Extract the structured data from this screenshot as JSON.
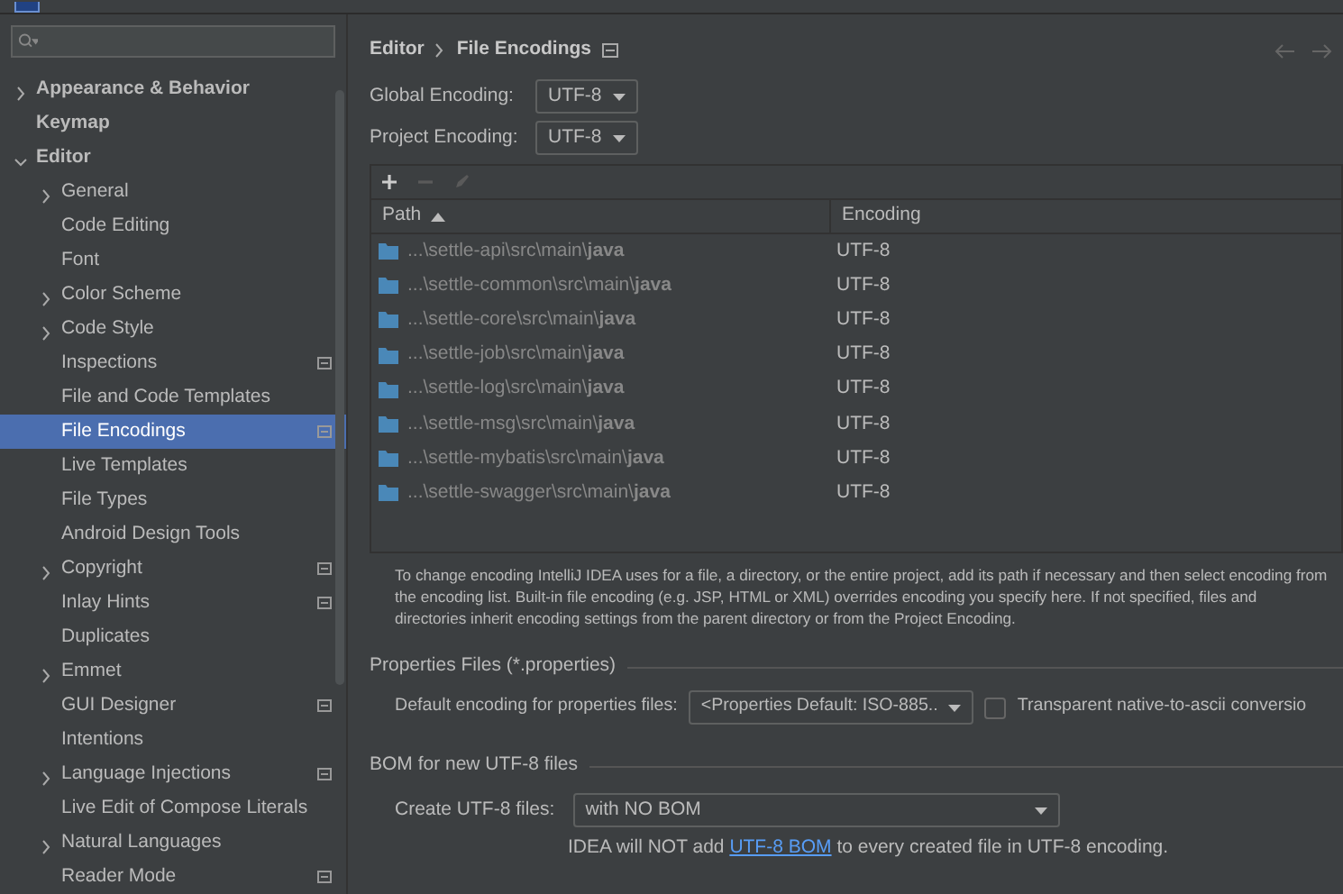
{
  "sidebar": {
    "items": [
      {
        "label": "Appearance & Behavior",
        "bold": true,
        "expanded": false,
        "selected": false
      },
      {
        "label": "Keymap",
        "bold": true,
        "selected": false
      },
      {
        "label": "Editor",
        "bold": true,
        "expanded": true,
        "selected": false,
        "children": [
          {
            "label": "General",
            "expanded": false,
            "selected": false
          },
          {
            "label": "Code Editing",
            "selected": false
          },
          {
            "label": "Font",
            "selected": false
          },
          {
            "label": "Color Scheme",
            "expanded": false,
            "selected": false
          },
          {
            "label": "Code Style",
            "expanded": false,
            "selected": false
          },
          {
            "label": "Inspections",
            "project_level": true,
            "selected": false
          },
          {
            "label": "File and Code Templates",
            "selected": false
          },
          {
            "label": "File Encodings",
            "project_level": true,
            "selected": true
          },
          {
            "label": "Live Templates",
            "selected": false
          },
          {
            "label": "File Types",
            "selected": false
          },
          {
            "label": "Android Design Tools",
            "selected": false
          },
          {
            "label": "Copyright",
            "expanded": false,
            "project_level": true,
            "selected": false
          },
          {
            "label": "Inlay Hints",
            "project_level": true,
            "selected": false
          },
          {
            "label": "Duplicates",
            "selected": false
          },
          {
            "label": "Emmet",
            "expanded": false,
            "selected": false
          },
          {
            "label": "GUI Designer",
            "project_level": true,
            "selected": false
          },
          {
            "label": "Intentions",
            "selected": false
          },
          {
            "label": "Language Injections",
            "expanded": false,
            "project_level": true,
            "selected": false
          },
          {
            "label": "Live Edit of Compose Literals",
            "selected": false
          },
          {
            "label": "Natural Languages",
            "expanded": false,
            "selected": false
          },
          {
            "label": "Reader Mode",
            "project_level": true,
            "selected": false
          }
        ]
      }
    ]
  },
  "breadcrumb": [
    "Editor",
    "File Encodings"
  ],
  "global_encoding": {
    "label": "Global Encoding:",
    "value": "UTF-8"
  },
  "project_encoding": {
    "label": "Project Encoding:",
    "value": "UTF-8"
  },
  "table": {
    "columns": [
      "Path",
      "Encoding"
    ],
    "rows": [
      {
        "path": "...\\settle-api\\src\\main\\**java**",
        "encoding": "UTF-8"
      },
      {
        "path": "...\\settle-common\\src\\main\\**java**",
        "encoding": "UTF-8"
      },
      {
        "path": "...\\settle-core\\src\\main\\**java**",
        "encoding": "UTF-8"
      },
      {
        "path": "...\\settle-job\\src\\main\\**java**",
        "encoding": "UTF-8"
      },
      {
        "path": "...\\settle-log\\src\\main\\**java**",
        "encoding": "UTF-8"
      },
      {
        "path": "...\\settle-msg\\src\\main\\**java**",
        "encoding": "UTF-8"
      },
      {
        "path": "...\\settle-mybatis\\src\\main\\**java**",
        "encoding": "UTF-8"
      },
      {
        "path": "...\\settle-swagger\\src\\main\\**java**",
        "encoding": "UTF-8"
      }
    ]
  },
  "description": "To change encoding IntelliJ IDEA uses for a file, a directory, or the entire project, add its path if necessary and then select encoding from the encoding list. Built-in file encoding (e.g. JSP, HTML or XML) overrides encoding you specify here. If not specified, files and directories inherit encoding settings from the parent directory or from the Project Encoding.",
  "properties_files": {
    "title": "Properties Files (*.properties)",
    "label": "Default encoding for properties files:",
    "value": "<Properties Default: ISO-885..",
    "transparent_conversion": {
      "label": "Transparent native-to-ascii conversio",
      "checked": false
    }
  },
  "bom": {
    "title": "BOM for new UTF-8 files",
    "label": "Create UTF-8 files:",
    "value": "with NO BOM",
    "note_before": "IDEA will NOT add",
    "note_link": "UTF-8 BOM",
    "note_after": "to every created file in UTF-8 encoding."
  }
}
